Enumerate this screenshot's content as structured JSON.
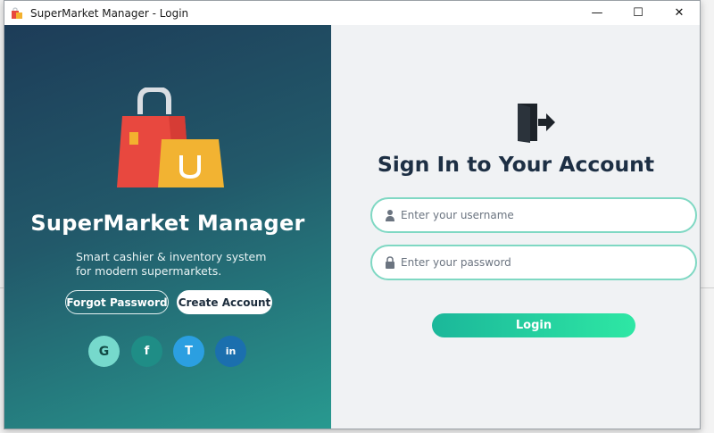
{
  "window": {
    "title": "SuperMarket Manager - Login",
    "controls": {
      "minimize": "—",
      "maximize": "☐",
      "close": "✕"
    }
  },
  "left_panel": {
    "brand": "SuperMarket Manager",
    "tagline_line1": "Smart cashier & inventory system",
    "tagline_line2": "for modern supermarkets.",
    "forgot_password_label": "Forgot Password",
    "create_account_label": "Create Account",
    "social": [
      {
        "icon": "google-icon",
        "glyph": "G"
      },
      {
        "icon": "facebook-icon",
        "glyph": "f"
      },
      {
        "icon": "twitter-icon",
        "glyph": "T"
      },
      {
        "icon": "linkedin-icon",
        "glyph": "in"
      }
    ],
    "colors": {
      "gradient_start": "#1d3c58",
      "gradient_end": "#289a90"
    }
  },
  "right_panel": {
    "icon": "sign-in-door-icon",
    "heading": "Sign In to Your Account",
    "username": {
      "placeholder": "Enter your username",
      "value": "",
      "icon": "user-icon"
    },
    "password": {
      "placeholder": "Enter your password",
      "value": "",
      "icon": "lock-icon"
    },
    "login_label": "Login",
    "colors": {
      "field_border": "#7fd8c3",
      "login_start": "#1bb79a",
      "login_end": "#2ee7a4",
      "heading": "#1d2f44"
    }
  }
}
